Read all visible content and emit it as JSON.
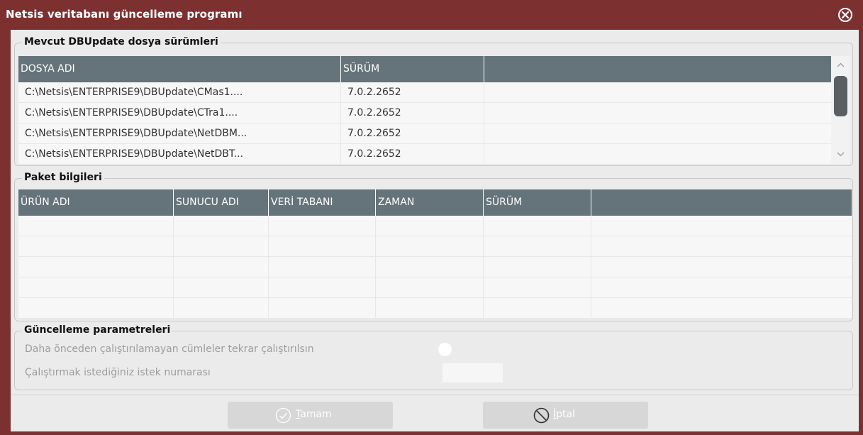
{
  "window": {
    "title": "Netsis veritabanı güncelleme programı",
    "close_icon": "close-circle-icon"
  },
  "files_group": {
    "title": "Mevcut DBUpdate dosya sürümleri",
    "columns": [
      "DOSYA ADI",
      "SÜRÜM"
    ],
    "rows": [
      {
        "name": "C:\\Netsis\\ENTERPRISE9\\DBUpdate\\CMas1....",
        "version": "7.0.2.2652"
      },
      {
        "name": "C:\\Netsis\\ENTERPRISE9\\DBUpdate\\CTra1....",
        "version": "7.0.2.2652"
      },
      {
        "name": "C:\\Netsis\\ENTERPRISE9\\DBUpdate\\NetDBM...",
        "version": "7.0.2.2652"
      },
      {
        "name": "C:\\Netsis\\ENTERPRISE9\\DBUpdate\\NetDBT...",
        "version": "7.0.2.2652"
      }
    ]
  },
  "package_group": {
    "title": "Paket bilgileri",
    "columns": [
      "ÜRÜN ADI",
      "SUNUCU ADI",
      "VERİ TABANI",
      "ZAMAN",
      "SÜRÜM"
    ]
  },
  "params_group": {
    "title": "Güncelleme parametreleri",
    "rerun_label": "Daha önceden çalıştırılamayan cümleler tekrar çalıştırılsın",
    "request_label": "Çalıştırmak istediğiniz istek numarası",
    "request_value": ""
  },
  "buttons": {
    "ok_prefix": "",
    "ok_mnemonic": "T",
    "ok_rest": "amam",
    "cancel_mnemonic": "İ",
    "cancel_rest": "ptal"
  },
  "colors": {
    "title_bar": "#7d3030",
    "grid_header": "#65737a",
    "panel": "#ebebeb"
  }
}
